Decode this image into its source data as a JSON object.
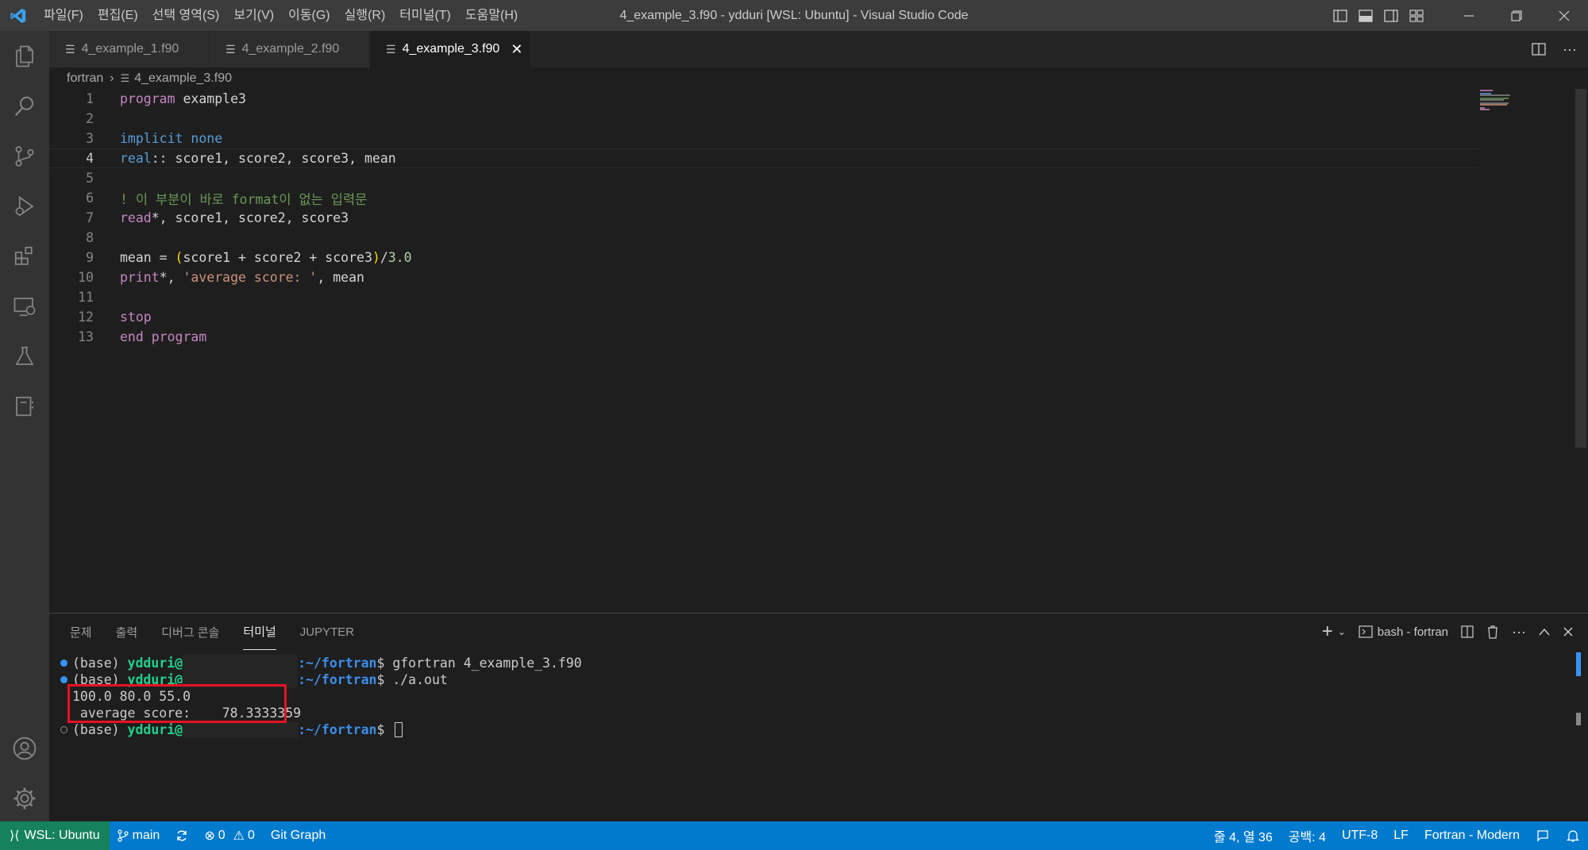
{
  "window": {
    "title": "4_example_3.f90 - ydduri [WSL: Ubuntu] - Visual Studio Code",
    "menu": [
      "파일(F)",
      "편집(E)",
      "선택 영역(S)",
      "보기(V)",
      "이동(G)",
      "실행(R)",
      "터미널(T)",
      "도움말(H)"
    ]
  },
  "tabs": [
    {
      "label": "4_example_1.f90",
      "active": false
    },
    {
      "label": "4_example_2.f90",
      "active": false
    },
    {
      "label": "4_example_3.f90",
      "active": true
    }
  ],
  "breadcrumb": {
    "folder": "fortran",
    "file": "4_example_3.f90"
  },
  "editor": {
    "current_line": 4,
    "line_numbers": [
      "1",
      "2",
      "3",
      "4",
      "5",
      "6",
      "7",
      "8",
      "9",
      "10",
      "11",
      "12",
      "13"
    ],
    "code": {
      "l1_kw": "program",
      "l1_rest": " example3",
      "l3_kw": "implicit none",
      "l4_kw": "real",
      "l4_rest": ":: score1, score2, score3, mean",
      "l6_comment": "! 이 부분이 바로 format이 없는 입력문",
      "l7_kw": "read",
      "l7_rest": "*, score1, score2, score3",
      "l9_a": "mean = ",
      "l9_open": "(",
      "l9_b": "score1 + score2 + score3",
      "l9_close": ")",
      "l9_c": "/",
      "l9_num": "3.0",
      "l10_kw": "print",
      "l10_a": "*, ",
      "l10_str": "'average score: '",
      "l10_b": ", mean",
      "l12_kw": "stop",
      "l13_kw": "end program"
    }
  },
  "panel": {
    "tabs": [
      "문제",
      "출력",
      "디버그 콘솔",
      "터미널",
      "JUPYTER"
    ],
    "active_tab": "터미널",
    "terminal_name": "bash - fortran",
    "lines": {
      "prompt_base": "(base) ",
      "prompt_user": "ydduri@",
      "prompt_path": ":~/fortran",
      "prompt_dollar": "$ ",
      "cmd1": "gfortran 4_example_3.f90",
      "cmd2": "./a.out",
      "out1": "100.0 80.0 55.0",
      "out2": " average score:    78.3333359"
    }
  },
  "statusbar": {
    "remote": "WSL: Ubuntu",
    "branch": "main",
    "errors": "0",
    "warnings": "0",
    "git_graph": "Git Graph",
    "position": "줄 4, 열 36",
    "spaces": "공백: 4",
    "encoding": "UTF-8",
    "eol": "LF",
    "language": "Fortran - Modern"
  },
  "colors": {
    "statusbar": "#007acc",
    "remote": "#16825d",
    "highlight_box": "#e81123"
  }
}
